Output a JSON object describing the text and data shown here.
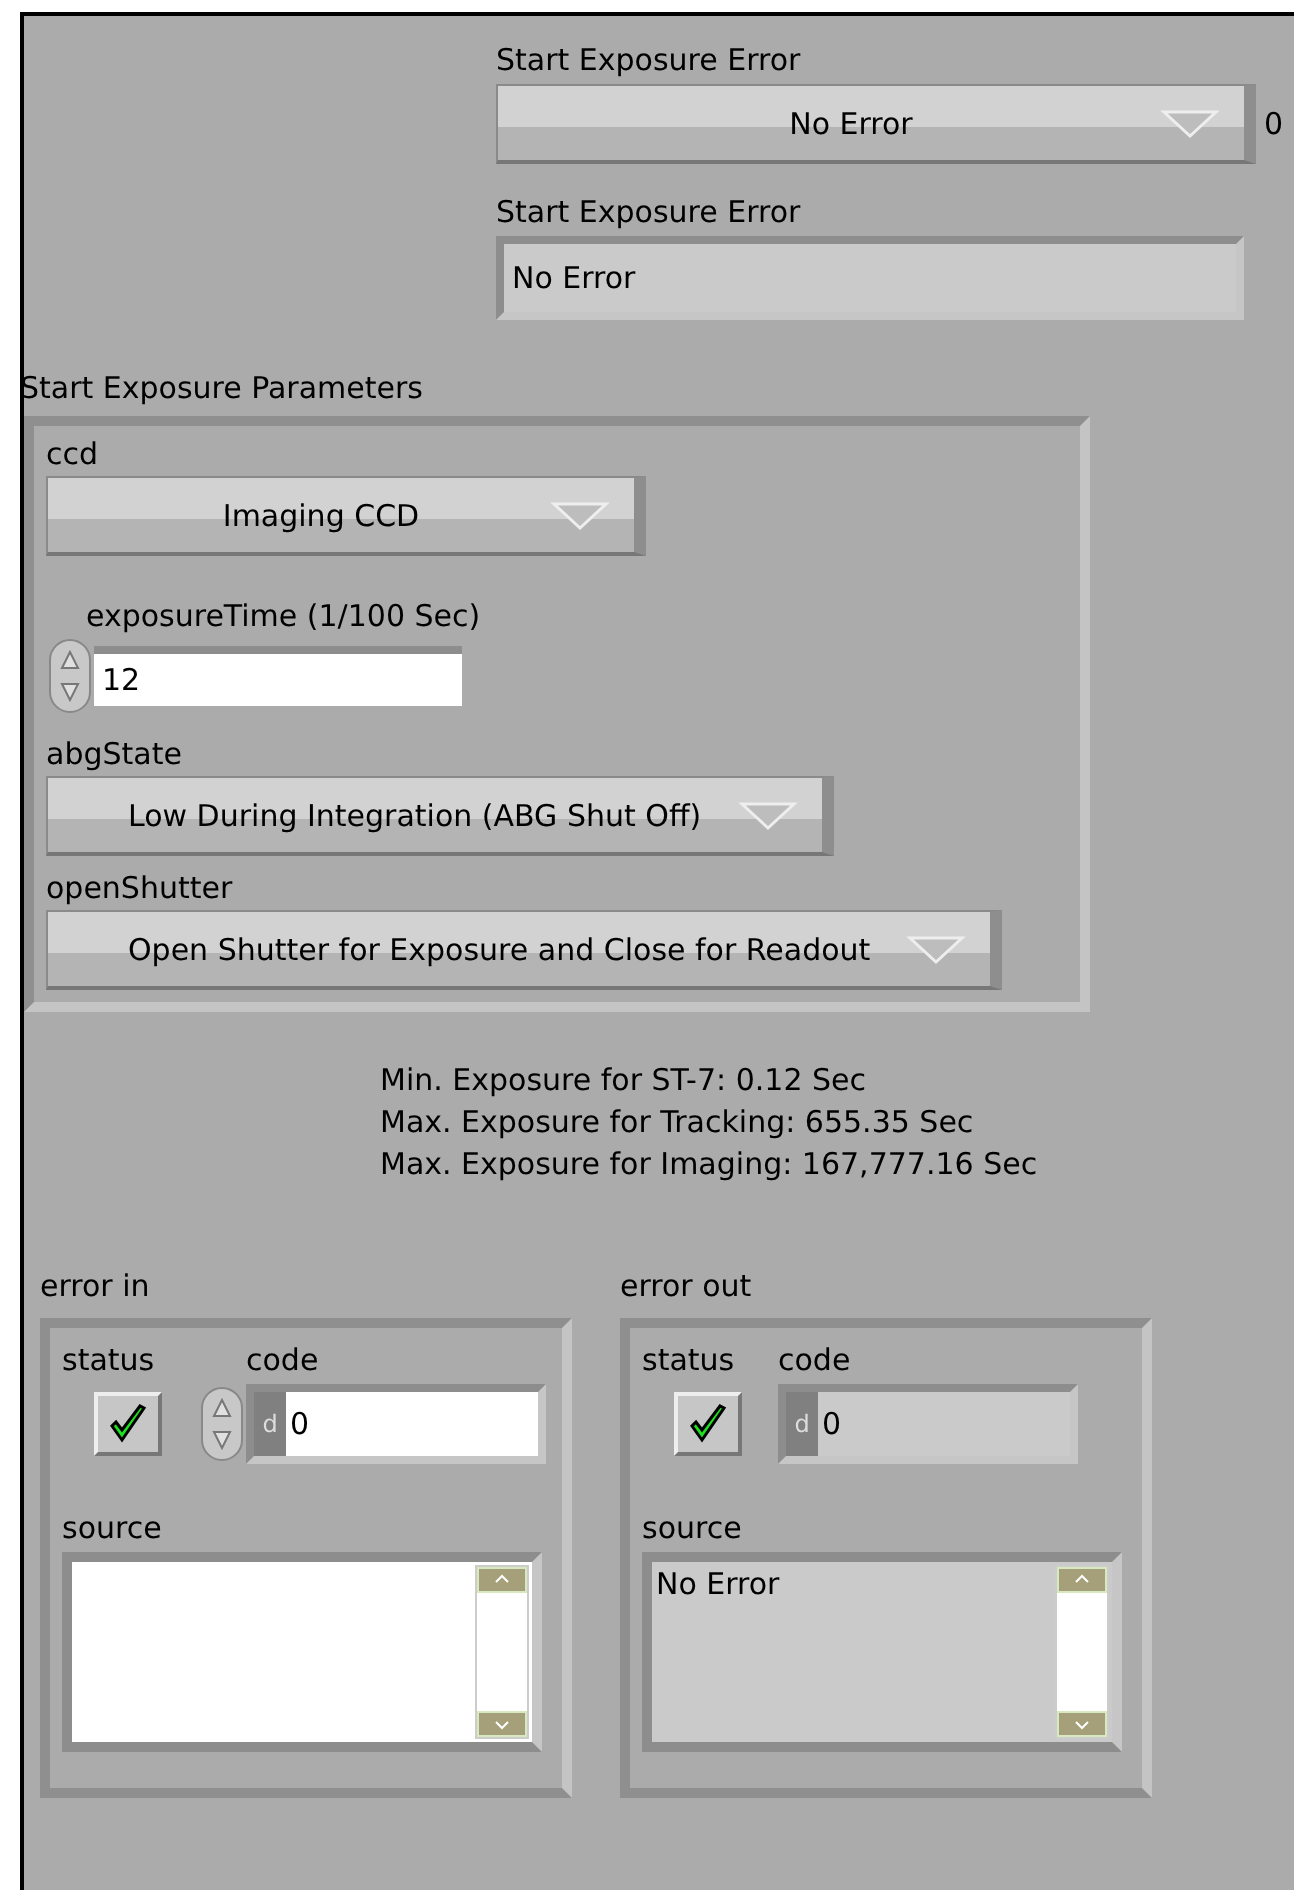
{
  "error_ring": {
    "label": "Start Exposure Error",
    "value": "No Error",
    "number": "0"
  },
  "error_string": {
    "label": "Start Exposure Error",
    "value": "No Error"
  },
  "parameters": {
    "label": "Start Exposure Parameters",
    "fields": [
      {
        "kind": "ring",
        "label": "ccd",
        "value": "Imaging CCD"
      },
      {
        "kind": "numeric",
        "label": "exposureTime (1/100 Sec)",
        "value": "12"
      },
      {
        "kind": "ring",
        "label": "abgState",
        "value": "Low During Integration (ABG Shut Off)"
      },
      {
        "kind": "ring",
        "label": "openShutter",
        "value": "Open Shutter for Exposure and Close for Readout"
      }
    ]
  },
  "notes": [
    "Min. Exposure for ST-7: 0.12 Sec",
    "Max. Exposure for Tracking: 655.35 Sec",
    "Max. Exposure for Imaging: 167,777.16 Sec"
  ],
  "error_clusters": [
    {
      "kind": "control",
      "label": "error in",
      "status_label": "status",
      "checked": true,
      "code_label": "code",
      "radix": "d",
      "code": "0",
      "source_label": "source"
    },
    {
      "kind": "indicator",
      "label": "error out",
      "status_label": "status",
      "checked": true,
      "code_label": "code",
      "radix": "d",
      "code": "0",
      "source_label": "source",
      "source": "No Error"
    }
  ]
}
